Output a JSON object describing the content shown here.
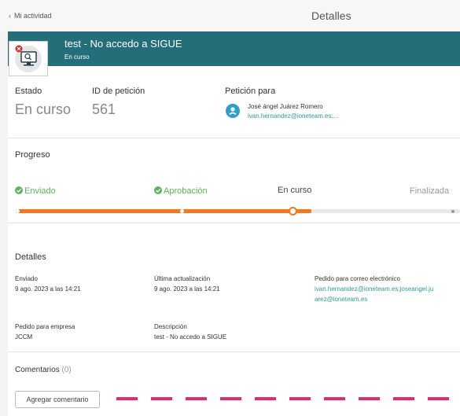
{
  "topbar": {
    "back_label": "Mi actividad",
    "title": "Detalles"
  },
  "header": {
    "title": "test - No accedo a SIGUE",
    "status": "En curso"
  },
  "summary": {
    "estado_label": "Estado",
    "estado_value": "En curso",
    "id_label": "ID de petición",
    "id_value": "561",
    "para_label": "Petición para",
    "para_name": "José ángel Juárez Romero",
    "para_email": "ivan.hernandez@ioneteam.es;..."
  },
  "progress": {
    "title": "Progreso",
    "steps": [
      {
        "label": "Enviado",
        "state": "done"
      },
      {
        "label": "Aprobación",
        "state": "done"
      },
      {
        "label": "En curso",
        "state": "current"
      },
      {
        "label": "Finalizada",
        "state": "pending"
      }
    ],
    "fill_fraction": 0.67,
    "colors": {
      "done": "#5db35d",
      "bar": "#f07a22"
    }
  },
  "details": {
    "title": "Detalles",
    "enviado_label": "Enviado",
    "enviado_value": "9 ago. 2023 a las 14:21",
    "ultima_label": "Última actualización",
    "ultima_value": "9 ago. 2023 a las 14:21",
    "correo_label": "Pedido para correo electrónico",
    "correo_line1": "ivan.hernandez@ioneteam.es;joseangel.ju",
    "correo_line2": "arez@ioneteam.es",
    "empresa_label": "Pedido para empresa",
    "empresa_value": "JCCM",
    "desc_label": "Descripción",
    "desc_value": "test - No accedo a SIGUE"
  },
  "comments": {
    "label": "Comentarios",
    "count": "(0)",
    "add_button": "Agregar comentario"
  },
  "colors": {
    "header": "#236e78",
    "accent_link": "#2e9c8f",
    "annotation_dash": "#e22d6a"
  }
}
